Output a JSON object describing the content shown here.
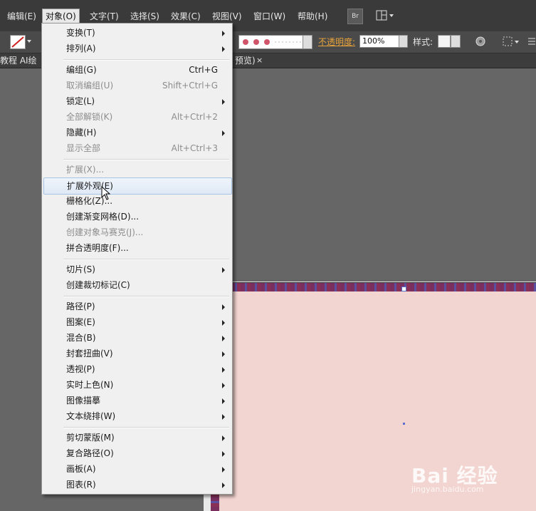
{
  "menubar": {
    "items": [
      {
        "label": "编辑(E)"
      },
      {
        "label": "对象(O)"
      },
      {
        "label": "文字(T)"
      },
      {
        "label": "选择(S)"
      },
      {
        "label": "效果(C)"
      },
      {
        "label": "视图(V)"
      },
      {
        "label": "窗口(W)"
      },
      {
        "label": "帮助(H)"
      }
    ],
    "bridge_label": "Br"
  },
  "options_bar": {
    "opacity_label": "不透明度:",
    "opacity_value": "100%",
    "style_label": "样式:"
  },
  "document_tab": {
    "left_text": "教程 AI绘",
    "right_text": "预览)",
    "close": "×"
  },
  "object_menu": {
    "items": [
      {
        "label": "变换(T)",
        "shortcut": "",
        "submenu": true,
        "disabled": false
      },
      {
        "label": "排列(A)",
        "shortcut": "",
        "submenu": true,
        "disabled": false
      },
      {
        "label": "编组(G)",
        "shortcut": "Ctrl+G",
        "submenu": false,
        "disabled": false
      },
      {
        "label": "取消编组(U)",
        "shortcut": "Shift+Ctrl+G",
        "submenu": false,
        "disabled": true
      },
      {
        "label": "锁定(L)",
        "shortcut": "",
        "submenu": true,
        "disabled": false
      },
      {
        "label": "全部解锁(K)",
        "shortcut": "Alt+Ctrl+2",
        "submenu": false,
        "disabled": true
      },
      {
        "label": "隐藏(H)",
        "shortcut": "",
        "submenu": true,
        "disabled": false
      },
      {
        "label": "显示全部",
        "shortcut": "Alt+Ctrl+3",
        "submenu": false,
        "disabled": true
      },
      {
        "label": "扩展(X)...",
        "shortcut": "",
        "submenu": false,
        "disabled": true
      },
      {
        "label": "扩展外观(E)",
        "shortcut": "",
        "submenu": false,
        "disabled": false,
        "highlighted": true
      },
      {
        "label": "栅格化(Z)...",
        "shortcut": "",
        "submenu": false,
        "disabled": false
      },
      {
        "label": "创建渐变网格(D)...",
        "shortcut": "",
        "submenu": false,
        "disabled": false
      },
      {
        "label": "创建对象马赛克(J)...",
        "shortcut": "",
        "submenu": false,
        "disabled": true
      },
      {
        "label": "拼合透明度(F)...",
        "shortcut": "",
        "submenu": false,
        "disabled": false
      },
      {
        "label": "切片(S)",
        "shortcut": "",
        "submenu": true,
        "disabled": false
      },
      {
        "label": "创建裁切标记(C)",
        "shortcut": "",
        "submenu": false,
        "disabled": false
      },
      {
        "label": "路径(P)",
        "shortcut": "",
        "submenu": true,
        "disabled": false
      },
      {
        "label": "图案(E)",
        "shortcut": "",
        "submenu": true,
        "disabled": false
      },
      {
        "label": "混合(B)",
        "shortcut": "",
        "submenu": true,
        "disabled": false
      },
      {
        "label": "封套扭曲(V)",
        "shortcut": "",
        "submenu": true,
        "disabled": false
      },
      {
        "label": "透视(P)",
        "shortcut": "",
        "submenu": true,
        "disabled": false
      },
      {
        "label": "实时上色(N)",
        "shortcut": "",
        "submenu": true,
        "disabled": false
      },
      {
        "label": "图像描摹",
        "shortcut": "",
        "submenu": true,
        "disabled": false
      },
      {
        "label": "文本绕排(W)",
        "shortcut": "",
        "submenu": true,
        "disabled": false
      },
      {
        "label": "剪切蒙版(M)",
        "shortcut": "",
        "submenu": true,
        "disabled": false
      },
      {
        "label": "复合路径(O)",
        "shortcut": "",
        "submenu": true,
        "disabled": false
      },
      {
        "label": "画板(A)",
        "shortcut": "",
        "submenu": true,
        "disabled": false
      },
      {
        "label": "图表(R)",
        "shortcut": "",
        "submenu": true,
        "disabled": false
      }
    ]
  },
  "watermark": {
    "brand": "Bai 经验",
    "url": "jingyan.baidu.com"
  },
  "colors": {
    "menu_bg": "#f0f0f0",
    "artboard": "#f2d4d0",
    "opacity_label": "#e8a23a",
    "highlight": "#dfe9f5"
  }
}
